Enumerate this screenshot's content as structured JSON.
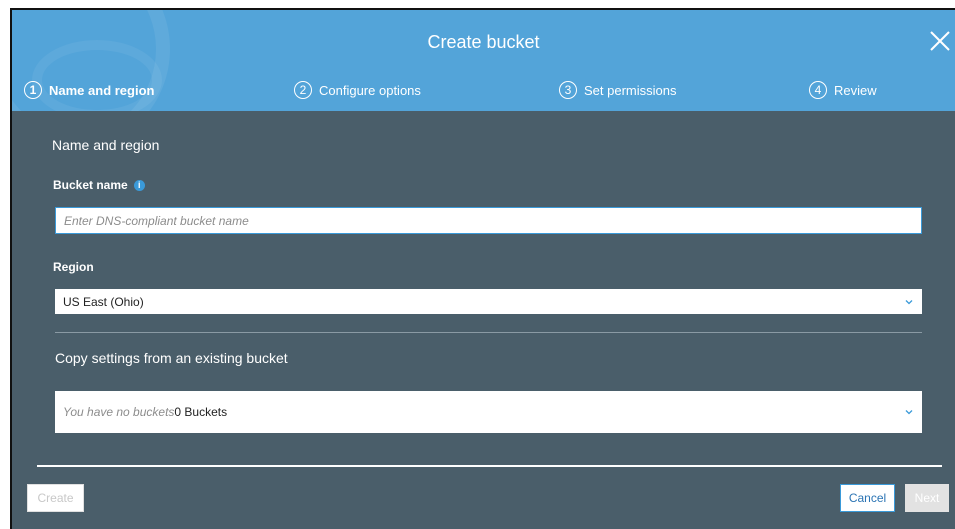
{
  "dialog": {
    "title": "Create bucket"
  },
  "steps": [
    {
      "num": "1",
      "label": "Name and region",
      "active": true
    },
    {
      "num": "2",
      "label": "Configure options",
      "active": false
    },
    {
      "num": "3",
      "label": "Set permissions",
      "active": false
    },
    {
      "num": "4",
      "label": "Review",
      "active": false
    }
  ],
  "form": {
    "section_title": "Name and region",
    "bucket_name_label": "Bucket name",
    "bucket_name_placeholder": "Enter DNS-compliant bucket name",
    "bucket_name_value": "",
    "region_label": "Region",
    "region_value": "US East (Ohio)",
    "copy_title": "Copy settings from an existing bucket",
    "copy_placeholder": "You have no buckets",
    "copy_count": "0 Buckets"
  },
  "footer": {
    "create_label": "Create",
    "cancel_label": "Cancel",
    "next_label": "Next"
  },
  "colors": {
    "header": "#53a4d9",
    "body": "#4a5e6a",
    "accent": "#3a9ad9"
  },
  "icons": [
    "close-icon",
    "info-icon",
    "chevron-down-icon"
  ]
}
